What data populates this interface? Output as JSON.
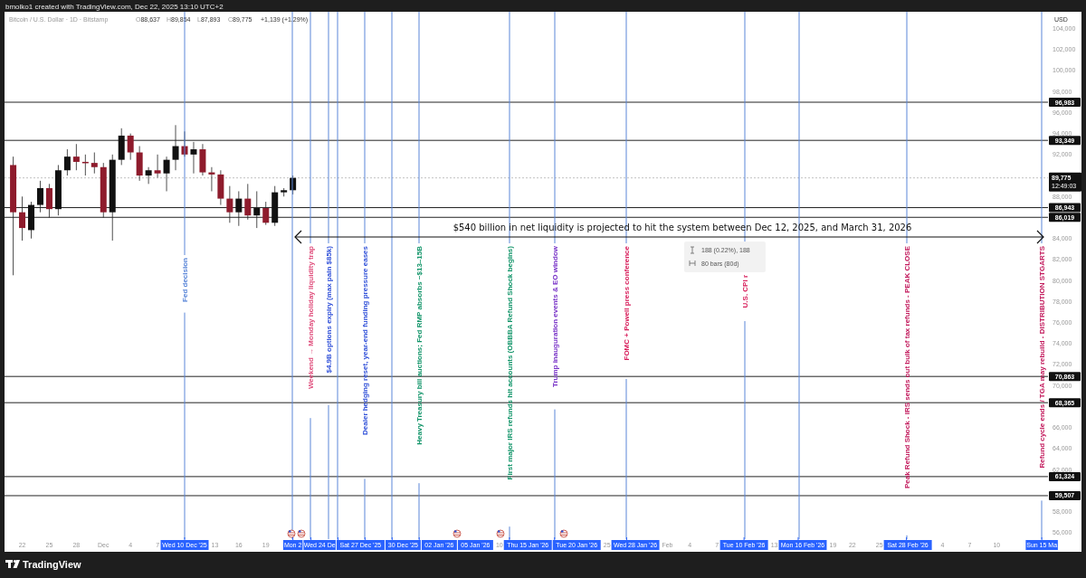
{
  "header": {
    "title": "bmolko1 created with TradingView.com, Dec 22, 2025 13:10 UTC+2"
  },
  "legend": {
    "symbol": "Bitcoin / U.S. Dollar · 1D · Bitstamp",
    "ohlc": [
      {
        "label": "O",
        "value": "88,637"
      },
      {
        "label": "H",
        "value": "89,854"
      },
      {
        "label": "L",
        "value": "87,893"
      },
      {
        "label": "C",
        "value": "89,775"
      }
    ],
    "change": "+1,139 (+1.29%)"
  },
  "price_axis": {
    "currency": "USD",
    "ticks": [
      "104,000",
      "102,000",
      "100,000",
      "98,000",
      "96,000",
      "94,000",
      "92,000",
      "88,000",
      "84,000",
      "82,000",
      "80,000",
      "78,000",
      "76,000",
      "74,000",
      "72,000",
      "70,000",
      "66,000",
      "64,000",
      "62,000",
      "58,000",
      "56,000"
    ]
  },
  "levels": [
    {
      "price": "96,983"
    },
    {
      "price": "93,349"
    },
    {
      "price": "86,943"
    },
    {
      "price": "86,019"
    },
    {
      "price": "70,863"
    },
    {
      "price": "68,365"
    },
    {
      "price": "61,324"
    },
    {
      "price": "59,507"
    }
  ],
  "last_price": {
    "price": "89,775",
    "countdown": "12:49:03"
  },
  "events": [
    {
      "label": "Fed decision",
      "color": "#5a86d8"
    },
    {
      "label": "Weekend → Monday holiday liquidity trap",
      "color": "#e0507e"
    },
    {
      "label": "$4.9B options expiry (max pain $85k)",
      "color": "#3252d9"
    },
    {
      "label": "Dealer hedging reset, year-end funding pressure eases",
      "color": "#3252d9"
    },
    {
      "label": "Heavy Treasury bill auctions; Fed RMP absorbs ~$13–15B",
      "color": "#109468"
    },
    {
      "label": "First major IRS refunds hit accounts (OBBBA Refund Shock begins)",
      "color": "#109468"
    },
    {
      "label": "Trump inauguration events & EO window",
      "color": "#7a35c8"
    },
    {
      "label": "FOMC + Powell press conference",
      "color": "#d81e5b"
    },
    {
      "label": "U.S. CPI r",
      "color": "#d81e5b"
    },
    {
      "label": "Peak Refund Shock - IRS sends out bulk of tax refunds - PEAK CLOSE",
      "color": "#c2185b"
    },
    {
      "label": "Refund cycle ends / TGA may rebuild - DISTRIBUTION STGARTS",
      "color": "#c2185b"
    }
  ],
  "annotation": {
    "text": "$540 billion in net liquidity is projected to hit the system between Dec 12, 2025, and March 31, 2026"
  },
  "tooltip": {
    "range": "188 (0.22%), 188",
    "bars": "80 bars (80d)"
  },
  "time_axis": [
    {
      "label": "22",
      "kind": "tick"
    },
    {
      "label": "25",
      "kind": "tick"
    },
    {
      "label": "28",
      "kind": "tick"
    },
    {
      "label": "Dec",
      "kind": "tick"
    },
    {
      "label": "4",
      "kind": "tick"
    },
    {
      "label": "7",
      "kind": "tick"
    },
    {
      "label": "Wed 10 Dec '25",
      "kind": "marker"
    },
    {
      "label": "13",
      "kind": "tick"
    },
    {
      "label": "16",
      "kind": "tick"
    },
    {
      "label": "19",
      "kind": "tick"
    },
    {
      "label": "Mon 2",
      "kind": "marker"
    },
    {
      "label": "Wed 24 De",
      "kind": "marker"
    },
    {
      "label": "Sat 27 Dec '25",
      "kind": "marker"
    },
    {
      "label": "30 Dec '25",
      "kind": "marker"
    },
    {
      "label": "02 Jan '26",
      "kind": "marker"
    },
    {
      "label": "05 Jan '26",
      "kind": "marker"
    },
    {
      "label": "10",
      "kind": "tick"
    },
    {
      "label": "Thu 15 Jan '26",
      "kind": "marker"
    },
    {
      "label": "Tue 20 Jan '26",
      "kind": "marker"
    },
    {
      "label": "25",
      "kind": "tick"
    },
    {
      "label": "Wed 28 Jan '26",
      "kind": "marker"
    },
    {
      "label": "Feb",
      "kind": "tick"
    },
    {
      "label": "4",
      "kind": "tick"
    },
    {
      "label": "7",
      "kind": "tick"
    },
    {
      "label": "Tue 10 Feb '26",
      "kind": "marker"
    },
    {
      "label": "13",
      "kind": "tick"
    },
    {
      "label": "Mon 16 Feb '26",
      "kind": "marker"
    },
    {
      "label": "19",
      "kind": "tick"
    },
    {
      "label": "22",
      "kind": "tick"
    },
    {
      "label": "25",
      "kind": "tick"
    },
    {
      "label": "Sat 28 Feb '26",
      "kind": "marker"
    },
    {
      "label": "4",
      "kind": "tick"
    },
    {
      "label": "7",
      "kind": "tick"
    },
    {
      "label": "10",
      "kind": "tick"
    },
    {
      "label": "Sun 15 Ma",
      "kind": "marker"
    }
  ],
  "footer": {
    "brand": "TradingView"
  }
}
